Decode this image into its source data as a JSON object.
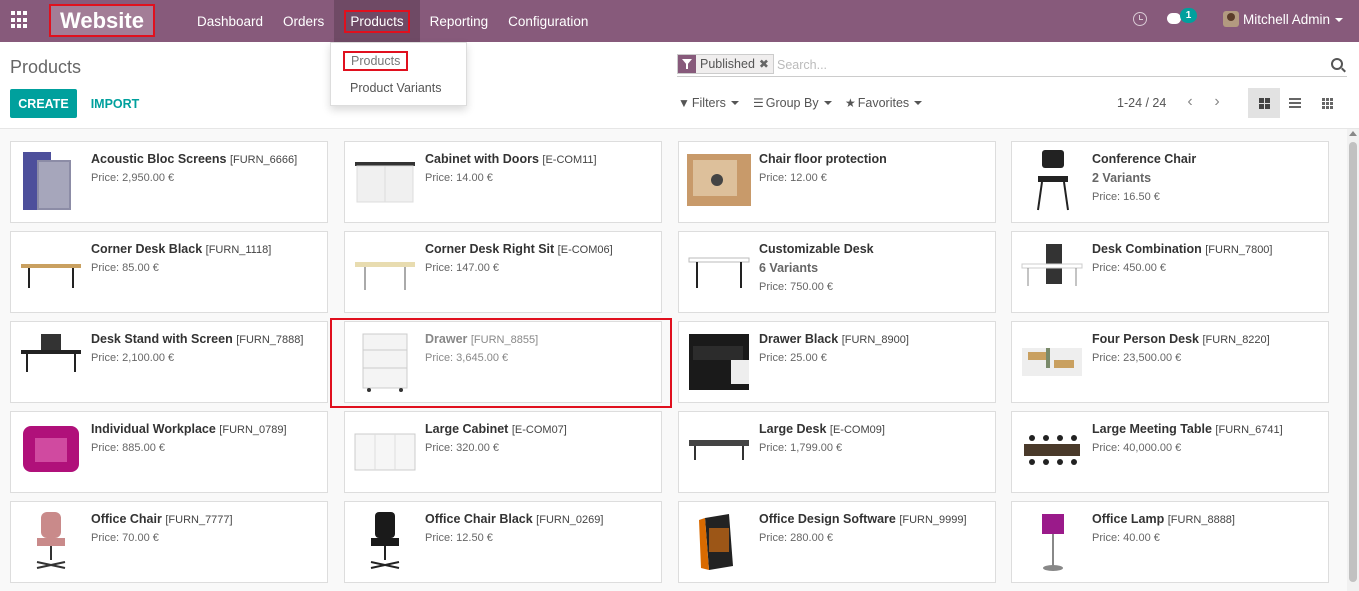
{
  "navbar": {
    "app_name": "Website",
    "menu": [
      "Dashboard",
      "Orders",
      "Products",
      "Reporting",
      "Configuration"
    ],
    "active_menu": "Products",
    "chat_badge": "1",
    "user": "Mitchell Admin"
  },
  "dropdown": {
    "items": [
      "Products",
      "Product Variants"
    ]
  },
  "control": {
    "title": "Products",
    "create_label": "CREATE",
    "import_label": "IMPORT",
    "facet_label": "Published",
    "facet_remove": "✖",
    "search_placeholder": "Search...",
    "filters_label": "Filters",
    "groupby_label": "Group By",
    "favorites_label": "Favorites",
    "pager": "1-24 / 24"
  },
  "products": [
    {
      "name": "Acoustic Bloc Screens",
      "ref": "[FURN_6666]",
      "price": "Price: 2,950.00 €",
      "variants": "",
      "icon": "acoustic-screen"
    },
    {
      "name": "Cabinet with Doors",
      "ref": "[E-COM11]",
      "price": "Price: 14.00 €",
      "variants": "",
      "icon": "cabinet"
    },
    {
      "name": "Chair floor protection",
      "ref": "",
      "price": "Price: 12.00 €",
      "variants": "",
      "icon": "floor-mat"
    },
    {
      "name": "Conference Chair",
      "ref": "",
      "price": "Price: 16.50 €",
      "variants": "2 Variants",
      "icon": "chair-black"
    },
    {
      "name": "Corner Desk Black",
      "ref": "[FURN_1118]",
      "price": "Price: 85.00 €",
      "variants": "",
      "icon": "desk"
    },
    {
      "name": "Corner Desk Right Sit",
      "ref": "[E-COM06]",
      "price": "Price: 147.00 €",
      "variants": "",
      "icon": "desk-light"
    },
    {
      "name": "Customizable Desk",
      "ref": "",
      "price": "Price: 750.00 €",
      "variants": "6 Variants",
      "icon": "desk-white"
    },
    {
      "name": "Desk Combination",
      "ref": "[FURN_7800]",
      "price": "Price: 450.00 €",
      "variants": "",
      "icon": "desk-combo"
    },
    {
      "name": "Desk Stand with Screen",
      "ref": "[FURN_7888]",
      "price": "Price: 2,100.00 €",
      "variants": "",
      "icon": "desk-screen"
    },
    {
      "name": "Drawer",
      "ref": "[FURN_8855]",
      "price": "Price: 3,645.00 €",
      "variants": "",
      "icon": "drawer-white"
    },
    {
      "name": "Drawer Black",
      "ref": "[FURN_8900]",
      "price": "Price: 25.00 €",
      "variants": "",
      "icon": "drawer-black"
    },
    {
      "name": "Four Person Desk",
      "ref": "[FURN_8220]",
      "price": "Price: 23,500.00 €",
      "variants": "",
      "icon": "four-desk"
    },
    {
      "name": "Individual Workplace",
      "ref": "[FURN_0789]",
      "price": "Price: 885.00 €",
      "variants": "",
      "icon": "workplace"
    },
    {
      "name": "Large Cabinet",
      "ref": "[E-COM07]",
      "price": "Price: 320.00 €",
      "variants": "",
      "icon": "large-cabinet"
    },
    {
      "name": "Large Desk",
      "ref": "[E-COM09]",
      "price": "Price: 1,799.00 €",
      "variants": "",
      "icon": "large-desk"
    },
    {
      "name": "Large Meeting Table",
      "ref": "[FURN_6741]",
      "price": "Price: 40,000.00 €",
      "variants": "",
      "icon": "meeting-table"
    },
    {
      "name": "Office Chair",
      "ref": "[FURN_7777]",
      "price": "Price: 70.00 €",
      "variants": "",
      "icon": "office-chair"
    },
    {
      "name": "Office Chair Black",
      "ref": "[FURN_0269]",
      "price": "Price: 12.50 €",
      "variants": "",
      "icon": "office-chair-black"
    },
    {
      "name": "Office Design Software",
      "ref": "[FURN_9999]",
      "price": "Price: 280.00 €",
      "variants": "",
      "icon": "software-box"
    },
    {
      "name": "Office Lamp",
      "ref": "[FURN_8888]",
      "price": "Price: 40.00 €",
      "variants": "",
      "icon": "lamp"
    }
  ],
  "colors": {
    "brand": "#875a7b",
    "accent": "#00a09d",
    "highlight": "#e0101e"
  }
}
